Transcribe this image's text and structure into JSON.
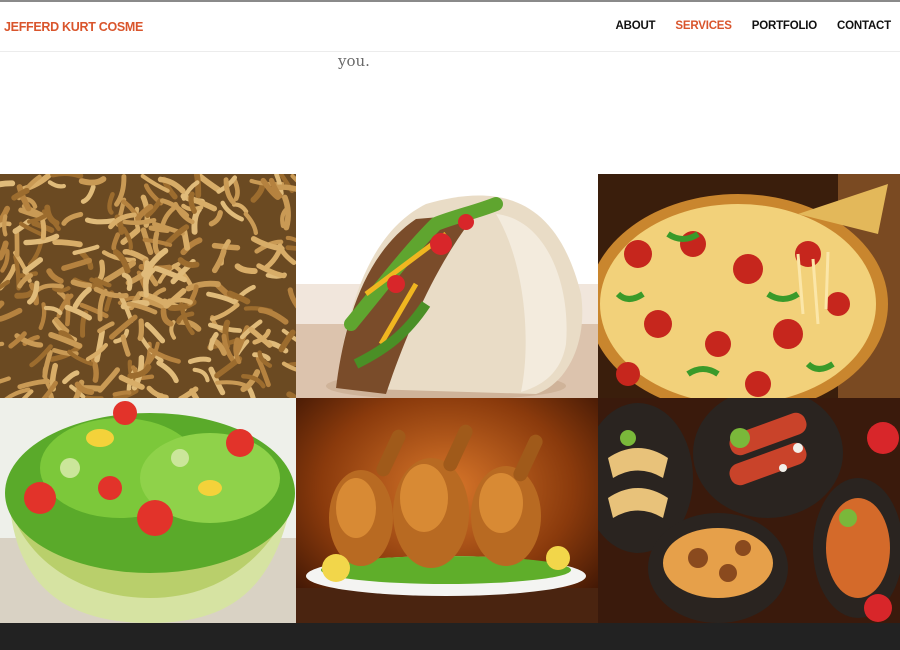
{
  "brand": {
    "name": "JEFFERD KURT COSME",
    "color": "#d9552c"
  },
  "nav": {
    "items": [
      {
        "label": "ABOUT",
        "active": false
      },
      {
        "label": "SERVICES",
        "active": true
      },
      {
        "label": "PORTFOLIO",
        "active": false
      },
      {
        "label": "CONTACT",
        "active": false
      }
    ],
    "active_color": "#d9552c",
    "default_color": "#111111"
  },
  "intro": {
    "text": "you."
  },
  "gallery": {
    "tiles": [
      {
        "name": "mealworms"
      },
      {
        "name": "taco"
      },
      {
        "name": "pizza"
      },
      {
        "name": "salad"
      },
      {
        "name": "roast-chicken"
      },
      {
        "name": "mexican-platter"
      }
    ]
  },
  "footer": {
    "color": "#222222"
  }
}
